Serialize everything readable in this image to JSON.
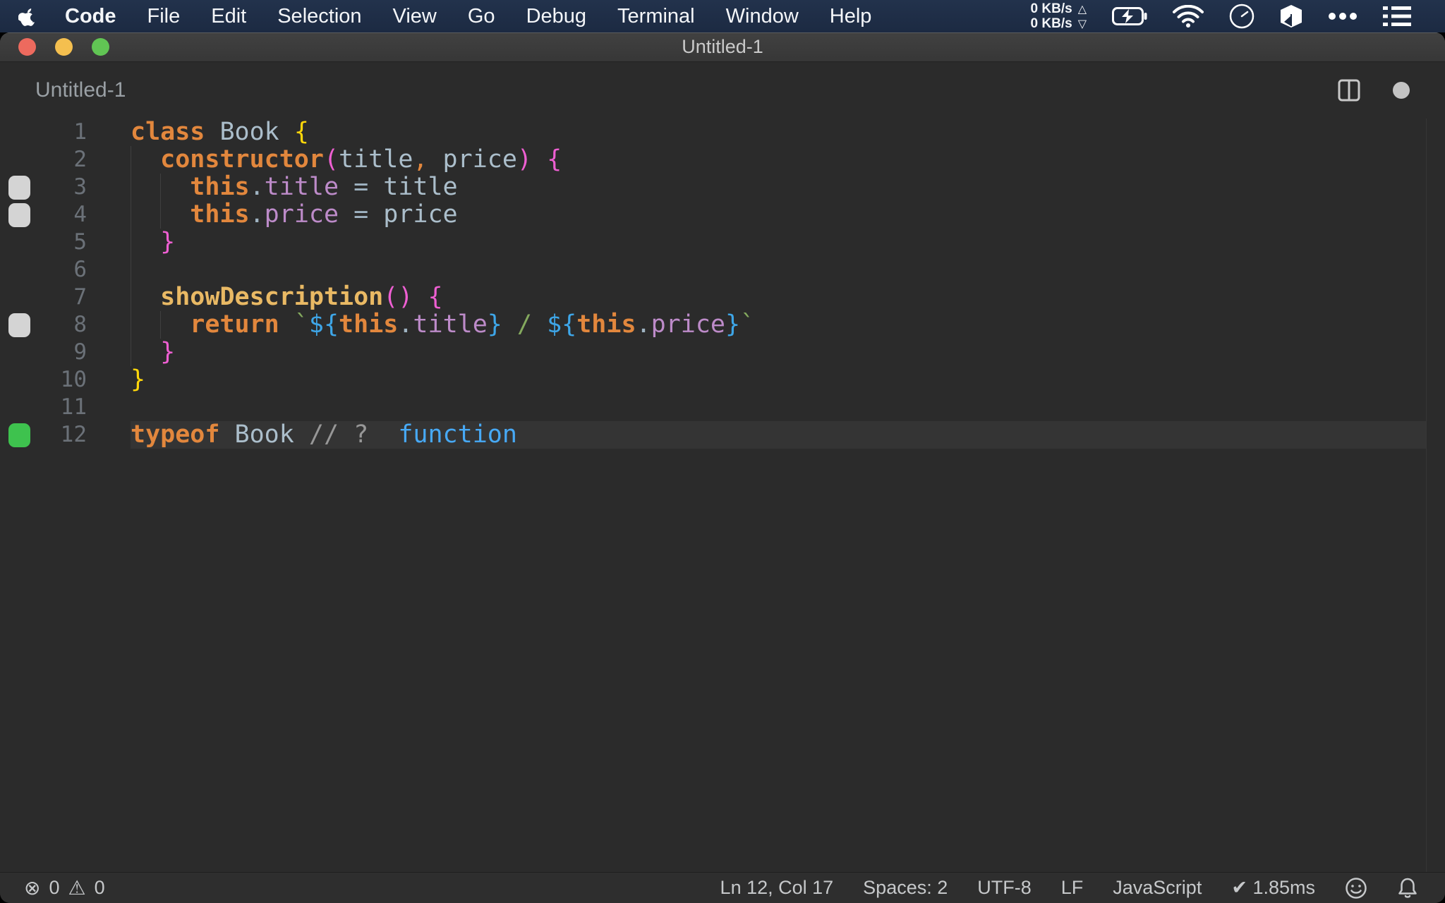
{
  "menu_bar": {
    "app_name": "Code",
    "menus": [
      "File",
      "Edit",
      "Selection",
      "View",
      "Go",
      "Debug",
      "Terminal",
      "Window",
      "Help"
    ],
    "network": {
      "up": "0 KB/s",
      "down": "0 KB/s"
    }
  },
  "window": {
    "title": "Untitled-1"
  },
  "editor": {
    "tab_label": "Untitled-1",
    "lines": [
      {
        "num": "1",
        "marker": null,
        "guides": [],
        "tokens": [
          [
            "kw",
            "class"
          ],
          [
            "plain",
            " "
          ],
          [
            "ident",
            "Book"
          ],
          [
            "plain",
            " "
          ],
          [
            "yellow",
            "{"
          ]
        ]
      },
      {
        "num": "2",
        "marker": null,
        "guides": [
          0
        ],
        "tokens": [
          [
            "plain",
            "  "
          ],
          [
            "kw",
            "constructor"
          ],
          [
            "pink",
            "("
          ],
          [
            "ident",
            "title"
          ],
          [
            "orange-punct",
            ","
          ],
          [
            "plain",
            " "
          ],
          [
            "ident",
            "price"
          ],
          [
            "pink",
            ")"
          ],
          [
            "plain",
            " "
          ],
          [
            "pink",
            "{"
          ]
        ]
      },
      {
        "num": "3",
        "marker": "gray",
        "guides": [
          0,
          2
        ],
        "tokens": [
          [
            "plain",
            "    "
          ],
          [
            "kw",
            "this"
          ],
          [
            "punct",
            "."
          ],
          [
            "purple",
            "title"
          ],
          [
            "plain",
            " "
          ],
          [
            "punct",
            "="
          ],
          [
            "plain",
            " "
          ],
          [
            "ident",
            "title"
          ]
        ]
      },
      {
        "num": "4",
        "marker": "gray",
        "guides": [
          0,
          2
        ],
        "tokens": [
          [
            "plain",
            "    "
          ],
          [
            "kw",
            "this"
          ],
          [
            "punct",
            "."
          ],
          [
            "purple",
            "price"
          ],
          [
            "plain",
            " "
          ],
          [
            "punct",
            "="
          ],
          [
            "plain",
            " "
          ],
          [
            "ident",
            "price"
          ]
        ]
      },
      {
        "num": "5",
        "marker": null,
        "guides": [
          0
        ],
        "tokens": [
          [
            "plain",
            "  "
          ],
          [
            "pink",
            "}"
          ]
        ]
      },
      {
        "num": "6",
        "marker": null,
        "guides": [
          0
        ],
        "tokens": []
      },
      {
        "num": "7",
        "marker": null,
        "guides": [
          0
        ],
        "tokens": [
          [
            "plain",
            "  "
          ],
          [
            "gold",
            "showDescription"
          ],
          [
            "pink",
            "()"
          ],
          [
            "plain",
            " "
          ],
          [
            "pink",
            "{"
          ]
        ]
      },
      {
        "num": "8",
        "marker": "gray",
        "guides": [
          0,
          2
        ],
        "tokens": [
          [
            "plain",
            "    "
          ],
          [
            "kw",
            "return"
          ],
          [
            "plain",
            " "
          ],
          [
            "green",
            "`"
          ],
          [
            "blue",
            "${"
          ],
          [
            "kw",
            "this"
          ],
          [
            "punct",
            "."
          ],
          [
            "purple",
            "title"
          ],
          [
            "blue",
            "}"
          ],
          [
            "green",
            " / "
          ],
          [
            "blue",
            "${"
          ],
          [
            "kw",
            "this"
          ],
          [
            "punct",
            "."
          ],
          [
            "purple",
            "price"
          ],
          [
            "blue",
            "}"
          ],
          [
            "green",
            "`"
          ]
        ]
      },
      {
        "num": "9",
        "marker": null,
        "guides": [
          0
        ],
        "tokens": [
          [
            "plain",
            "  "
          ],
          [
            "pink",
            "}"
          ]
        ]
      },
      {
        "num": "10",
        "marker": null,
        "guides": [],
        "tokens": [
          [
            "yellow",
            "}"
          ]
        ]
      },
      {
        "num": "11",
        "marker": null,
        "guides": [],
        "tokens": []
      },
      {
        "num": "12",
        "marker": "green",
        "current": true,
        "guides": [],
        "tokens": [
          [
            "kw",
            "typeof"
          ],
          [
            "plain",
            " "
          ],
          [
            "ident",
            "Book"
          ],
          [
            "plain",
            " "
          ],
          [
            "comment",
            "// ?"
          ],
          [
            "log",
            "  function"
          ]
        ]
      }
    ]
  },
  "status_bar": {
    "errors": "0",
    "warnings": "0",
    "items": [
      {
        "id": "cursor-position",
        "text": "Ln 12, Col 17"
      },
      {
        "id": "indentation",
        "text": "Spaces: 2"
      },
      {
        "id": "encoding",
        "text": "UTF-8"
      },
      {
        "id": "eol",
        "text": "LF"
      },
      {
        "id": "language-mode",
        "text": "JavaScript"
      },
      {
        "id": "quokka-run-time",
        "text": "✔ 1.85ms"
      }
    ]
  },
  "colors": {
    "menu_bar_bg": "#1c2a42",
    "editor_bg": "#2b2b2b",
    "current_line_bg": "#343434",
    "keyword_orange": "#e2873d",
    "identifier_blue_gray": "#abbecb",
    "brace_yellow": "#ffd60a",
    "brace_pink": "#ee5fd2",
    "property_purple": "#bd8bc9",
    "method_gold": "#e9b964",
    "string_green": "#84a95e",
    "template_blue": "#3ea6e8",
    "comment_gray": "#979797",
    "inline_log_blue": "#47a9f5",
    "coverage_gray": "#d4d4d4",
    "coverage_green": "#3ec24e",
    "traffic_red": "#ed6a5e",
    "traffic_yellow": "#f4bf4f",
    "traffic_green": "#61c554"
  }
}
